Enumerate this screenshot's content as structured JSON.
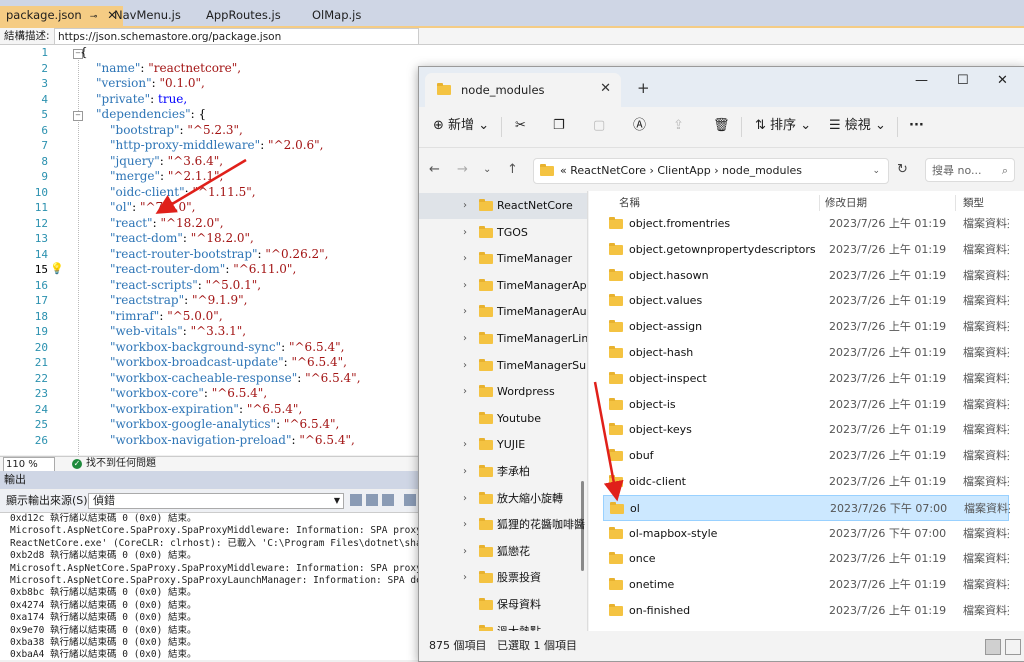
{
  "vs": {
    "tabs": [
      {
        "label": "package.json",
        "pin": "⊸",
        "close": "✕"
      },
      {
        "label": "NavMenu.js"
      },
      {
        "label": "AppRoutes.js"
      },
      {
        "label": "OlMap.js"
      }
    ],
    "schema_label": "結構描述:",
    "schema_url": "https://json.schemastore.org/package.json",
    "code_lines": [
      {
        "n": "1",
        "k": "",
        "v": "",
        "raw": "{"
      },
      {
        "n": "2",
        "k": "\"name\"",
        "v": "\"reactnetcore\","
      },
      {
        "n": "3",
        "k": "\"version\"",
        "v": "\"0.1.0\","
      },
      {
        "n": "4",
        "k": "\"private\"",
        "v": "true,"
      },
      {
        "n": "5",
        "k": "\"dependencies\"",
        "v": "{"
      },
      {
        "n": "6",
        "k": "\"bootstrap\"",
        "v": "\"^5.2.3\","
      },
      {
        "n": "7",
        "k": "\"http-proxy-middleware\"",
        "v": "\"^2.0.6\","
      },
      {
        "n": "8",
        "k": "\"jquery\"",
        "v": "\"^3.6.4\","
      },
      {
        "n": "9",
        "k": "\"merge\"",
        "v": "\"^2.1.1\","
      },
      {
        "n": "10",
        "k": "\"oidc-client\"",
        "v": "\"^1.11.5\","
      },
      {
        "n": "11",
        "k": "\"ol\"",
        "v": "\"^7.4.0\","
      },
      {
        "n": "12",
        "k": "\"react\"",
        "v": "\"^18.2.0\","
      },
      {
        "n": "13",
        "k": "\"react-dom\"",
        "v": "\"^18.2.0\","
      },
      {
        "n": "14",
        "k": "\"react-router-bootstrap\"",
        "v": "\"^0.26.2\","
      },
      {
        "n": "15",
        "k": "\"react-router-dom\"",
        "v": "\"^6.11.0\","
      },
      {
        "n": "16",
        "k": "\"react-scripts\"",
        "v": "\"^5.0.1\","
      },
      {
        "n": "17",
        "k": "\"reactstrap\"",
        "v": "\"^9.1.9\","
      },
      {
        "n": "18",
        "k": "\"rimraf\"",
        "v": "\"^5.0.0\","
      },
      {
        "n": "19",
        "k": "\"web-vitals\"",
        "v": "\"^3.3.1\","
      },
      {
        "n": "20",
        "k": "\"workbox-background-sync\"",
        "v": "\"^6.5.4\","
      },
      {
        "n": "21",
        "k": "\"workbox-broadcast-update\"",
        "v": "\"^6.5.4\","
      },
      {
        "n": "22",
        "k": "\"workbox-cacheable-response\"",
        "v": "\"^6.5.4\","
      },
      {
        "n": "23",
        "k": "\"workbox-core\"",
        "v": "\"^6.5.4\","
      },
      {
        "n": "24",
        "k": "\"workbox-expiration\"",
        "v": "\"^6.5.4\","
      },
      {
        "n": "25",
        "k": "\"workbox-google-analytics\"",
        "v": "\"^6.5.4\","
      },
      {
        "n": "26",
        "k": "\"workbox-navigation-preload\"",
        "v": "\"^6.5.4\","
      }
    ],
    "zoom": "110 %",
    "status_text": "找不到任何問題",
    "output_title": "輸出",
    "output_source_label": "顯示輸出來源(S):",
    "output_source_value": "偵錯",
    "output_lines": [
      "0xd12c 執行緒以結束碼 0 (0x0) 結束。",
      "Microsoft.AspNetCore.SpaProxy.SpaProxyMiddleware: Information: SPA proxy is not r",
      "ReactNetCore.exe' (CoreCLR: clrhost): 已載入 'C:\\Program Files\\dotnet\\shared\\Micr",
      "0xb2d8 執行緒以結束碼 0 (0x0) 結束。",
      "Microsoft.AspNetCore.SpaProxy.SpaProxyMiddleware: Information: SPA proxy is ready",
      "Microsoft.AspNetCore.SpaProxy.SpaProxyLaunchManager: Information: SPA development",
      "0xb8bc 執行緒以結束碼 0 (0x0) 結束。",
      "0x4274 執行緒以結束碼 0 (0x0) 結束。",
      "0xa174 執行緒以結束碼 0 (0x0) 結束。",
      "0x9e70 執行緒以結束碼 0 (0x0) 結束。",
      "0xba38 執行緒以結束碼 0 (0x0) 結束。",
      "0xbaA4 執行緒以結束碼 0 (0x0) 結束。"
    ]
  },
  "explorer": {
    "tab_title": "node_modules",
    "toolbar": {
      "new": "新增",
      "sort": "排序",
      "view": "檢視",
      "more": "···"
    },
    "breadcrumb": "«  ReactNetCore  ›  ClientApp  ›  node_modules",
    "search_placeholder": "搜尋 no...",
    "nav_items": [
      "ReactNetCore",
      "TGOS",
      "TimeManager",
      "TimeManagerAp",
      "TimeManagerAu",
      "TimeManagerLin",
      "TimeManagerSu",
      "Wordpress",
      "Youtube",
      "YUJIE",
      "李承柏",
      "放大縮小旋轉",
      "狐狸的花醬咖啡醬",
      "狐戀花",
      "股票投資",
      "保母資料",
      "溫大熱點"
    ],
    "columns": {
      "name": "名稱",
      "date": "修改日期",
      "type": "類型"
    },
    "rows": [
      {
        "name": "object.fromentries",
        "date": "2023/7/26 上午 01:19",
        "type": "檔案資料夾"
      },
      {
        "name": "object.getownpropertydescriptors",
        "date": "2023/7/26 上午 01:19",
        "type": "檔案資料夾"
      },
      {
        "name": "object.hasown",
        "date": "2023/7/26 上午 01:19",
        "type": "檔案資料夾"
      },
      {
        "name": "object.values",
        "date": "2023/7/26 上午 01:19",
        "type": "檔案資料夾"
      },
      {
        "name": "object-assign",
        "date": "2023/7/26 上午 01:19",
        "type": "檔案資料夾"
      },
      {
        "name": "object-hash",
        "date": "2023/7/26 上午 01:19",
        "type": "檔案資料夾"
      },
      {
        "name": "object-inspect",
        "date": "2023/7/26 上午 01:19",
        "type": "檔案資料夾"
      },
      {
        "name": "object-is",
        "date": "2023/7/26 上午 01:19",
        "type": "檔案資料夾"
      },
      {
        "name": "object-keys",
        "date": "2023/7/26 上午 01:19",
        "type": "檔案資料夾"
      },
      {
        "name": "obuf",
        "date": "2023/7/26 上午 01:19",
        "type": "檔案資料夾"
      },
      {
        "name": "oidc-client",
        "date": "2023/7/26 上午 01:19",
        "type": "檔案資料夾"
      },
      {
        "name": "ol",
        "date": "2023/7/26 下午 07:00",
        "type": "檔案資料夾"
      },
      {
        "name": "ol-mapbox-style",
        "date": "2023/7/26 下午 07:00",
        "type": "檔案資料夾"
      },
      {
        "name": "once",
        "date": "2023/7/26 上午 01:19",
        "type": "檔案資料夾"
      },
      {
        "name": "onetime",
        "date": "2023/7/26 上午 01:19",
        "type": "檔案資料夾"
      },
      {
        "name": "on-finished",
        "date": "2023/7/26 上午 01:19",
        "type": "檔案資料夾"
      }
    ],
    "selected_row": "ol",
    "status_count": "875 個項目",
    "status_selected": "已選取 1 個項目"
  },
  "colors": {
    "accent_arrow": "#e0201a",
    "tab_active": "#f5cc84",
    "selection": "#cce8ff",
    "folder": "#f4c342"
  }
}
